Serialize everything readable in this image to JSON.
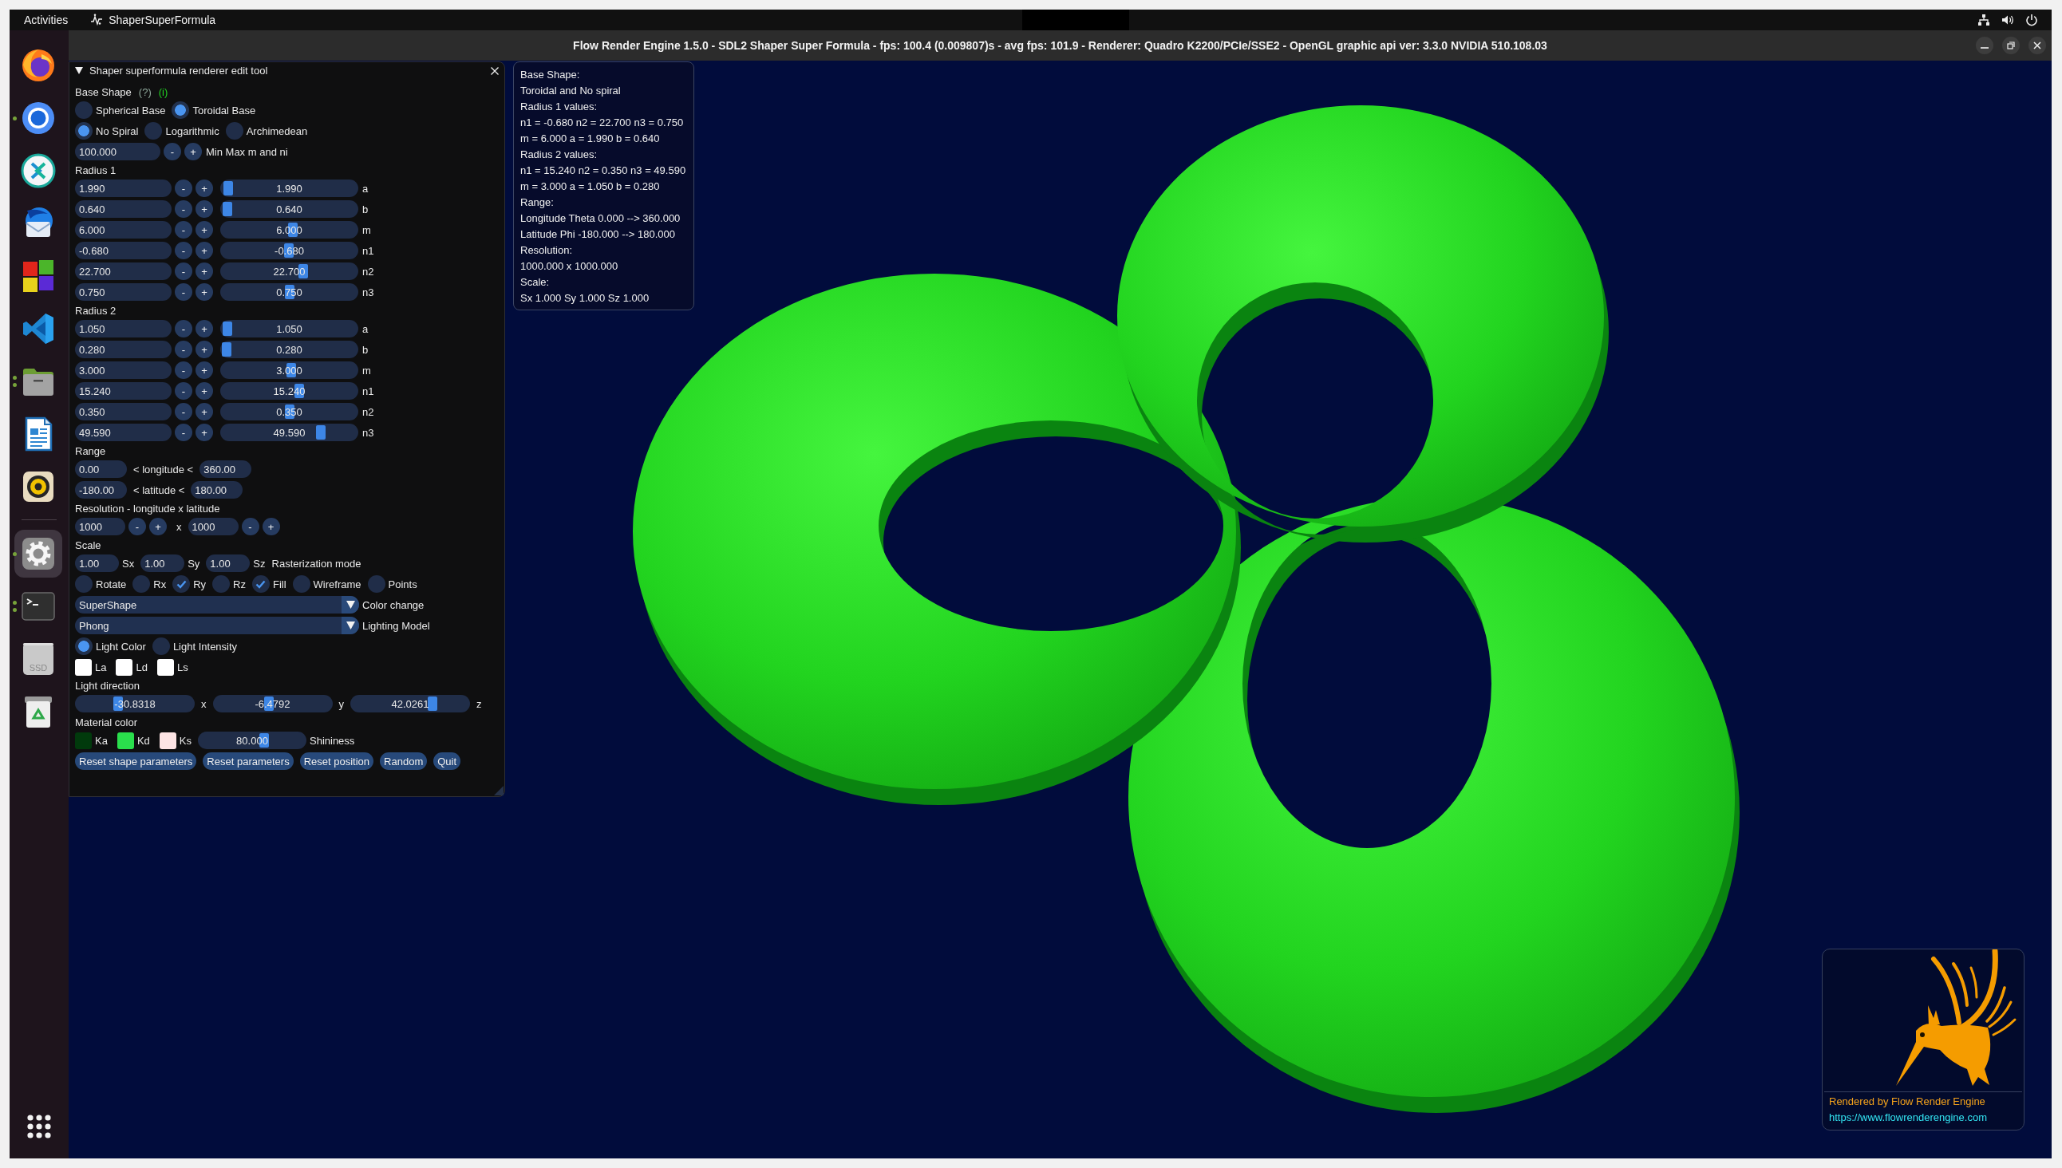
{
  "top_bar": {
    "activities": "Activities",
    "app_menu": "ShaperSuperFormula"
  },
  "dock": {
    "pinned": [
      {
        "kind": "fox",
        "running": false,
        "extra_window": false,
        "selected": false
      },
      {
        "kind": "ring",
        "running": true,
        "extra_window": false,
        "selected": false
      },
      {
        "kind": "arrows",
        "running": false,
        "extra_window": false,
        "selected": false
      },
      {
        "kind": "mail",
        "running": false,
        "extra_window": false,
        "selected": false
      },
      {
        "kind": "tiles",
        "running": false,
        "extra_window": false,
        "selected": false
      },
      {
        "kind": "code",
        "running": false,
        "extra_window": false,
        "selected": false
      },
      {
        "kind": "folder",
        "running": true,
        "extra_window": true,
        "selected": false
      },
      {
        "kind": "document",
        "running": false,
        "extra_window": false,
        "selected": false
      },
      {
        "kind": "speaker",
        "running": false,
        "extra_window": false,
        "selected": false
      }
    ],
    "running": [
      {
        "kind": "gear",
        "running": true,
        "extra_window": false,
        "selected": true
      },
      {
        "kind": "terminal",
        "running": true,
        "extra_window": true,
        "selected": false
      },
      {
        "kind": "disk",
        "label": "SSD",
        "running": false,
        "extra_window": false,
        "selected": false
      },
      {
        "kind": "trash",
        "running": false,
        "extra_window": false,
        "selected": false
      }
    ]
  },
  "window": {
    "title": "Flow Render Engine 1.5.0 - SDL2 Shaper Super Formula - fps: 100.4 (0.009807)s - avg fps: 101.9 - Renderer: Quadro K2200/PCIe/SSE2 - OpenGL graphic api ver: 3.3.0 NVIDIA 510.108.03"
  },
  "edit_panel": {
    "title": "Shaper superformula renderer edit tool",
    "expanded": true,
    "base_shape": {
      "label": "Base Shape",
      "help": "(?)",
      "info": "(i)"
    },
    "base_options": [
      {
        "label": "Spherical Base",
        "selected": false
      },
      {
        "label": "Toroidal Base",
        "selected": true
      }
    ],
    "spiral_options": [
      {
        "label": "No Spiral",
        "selected": true
      },
      {
        "label": "Logarithmic",
        "selected": false
      },
      {
        "label": "Archimedean",
        "selected": false
      }
    ],
    "min_max": {
      "value": "100.000",
      "minus": "-",
      "plus": "+",
      "label": "Min Max m and ni"
    },
    "radius_groups": [
      {
        "label": "Radius 1",
        "params": [
          {
            "value": "1.990",
            "minus": "-",
            "plus": "+",
            "slider_value": "1.990",
            "level": 0.013,
            "name": "a"
          },
          {
            "value": "0.640",
            "minus": "-",
            "plus": "+",
            "slider_value": "0.640",
            "level": 0.004,
            "name": "b"
          },
          {
            "value": "6.000",
            "minus": "-",
            "plus": "+",
            "slider_value": "6.000",
            "level": 0.53,
            "name": "m"
          },
          {
            "value": "-0.680",
            "minus": "-",
            "plus": "+",
            "slider_value": "-0.680",
            "level": 0.494,
            "name": "n1"
          },
          {
            "value": "22.700",
            "minus": "-",
            "plus": "+",
            "slider_value": "22.700",
            "level": 0.614,
            "name": "n2"
          },
          {
            "value": "0.750",
            "minus": "-",
            "plus": "+",
            "slider_value": "0.750",
            "level": 0.504,
            "name": "n3"
          }
        ]
      },
      {
        "label": "Radius 2",
        "params": [
          {
            "value": "1.050",
            "minus": "-",
            "plus": "+",
            "slider_value": "1.050",
            "level": 0.007,
            "name": "a"
          },
          {
            "value": "0.280",
            "minus": "-",
            "plus": "+",
            "slider_value": "0.280",
            "level": 0.002,
            "name": "b"
          },
          {
            "value": "3.000",
            "minus": "-",
            "plus": "+",
            "slider_value": "3.000",
            "level": 0.517,
            "name": "m"
          },
          {
            "value": "15.240",
            "minus": "-",
            "plus": "+",
            "slider_value": "15.240",
            "level": 0.579,
            "name": "n1"
          },
          {
            "value": "0.350",
            "minus": "-",
            "plus": "+",
            "slider_value": "0.350",
            "level": 0.504,
            "name": "n2"
          },
          {
            "value": "49.590",
            "minus": "-",
            "plus": "+",
            "slider_value": "49.590",
            "level": 0.751,
            "name": "n3"
          }
        ]
      }
    ],
    "range": {
      "label": "Range",
      "rows": [
        {
          "min": "0.00",
          "relation": "< longitude <",
          "max": "360.00"
        },
        {
          "min": "-180.00",
          "relation": "< latitude <",
          "max": "180.00"
        }
      ]
    },
    "resolution": {
      "label": "Resolution - longitude x latitude",
      "fields": [
        {
          "value": "1000",
          "minus": "-",
          "plus": "+"
        },
        {
          "value": "1000",
          "minus": "-",
          "plus": "+"
        }
      ],
      "separator": "x"
    },
    "scale": {
      "label": "Scale",
      "fields": [
        {
          "value": "1.00",
          "axis": "Sx"
        },
        {
          "value": "1.00",
          "axis": "Sy"
        },
        {
          "value": "1.00",
          "axis": "Sz"
        }
      ],
      "mode_label": "Rasterization mode"
    },
    "toggles": [
      {
        "label": "Rotate",
        "checked": false
      },
      {
        "label": "Rx",
        "checked": false
      },
      {
        "label": "Ry",
        "checked": true
      },
      {
        "label": "Rz",
        "checked": false
      },
      {
        "label": "Fill",
        "checked": true
      },
      {
        "label": "Wireframe",
        "checked": false
      },
      {
        "label": "Points",
        "checked": false
      }
    ],
    "combos": [
      {
        "value": "SuperShape",
        "label": "Color change"
      },
      {
        "value": "Phong",
        "label": "Lighting Model"
      }
    ],
    "light_modes": [
      {
        "label": "Light Color",
        "selected": true
      },
      {
        "label": "Light Intensity",
        "selected": false
      }
    ],
    "light_colors": [
      {
        "label": "La",
        "color": "#ffffff"
      },
      {
        "label": "Ld",
        "color": "#ffffff"
      },
      {
        "label": "Ls",
        "color": "#ffffff"
      }
    ],
    "light_direction": {
      "label": "Light direction",
      "sliders": [
        {
          "value": "-30.8318",
          "level": 0.342,
          "axis": "x"
        },
        {
          "value": "-6.4792",
          "level": 0.465,
          "axis": "y"
        },
        {
          "value": "42.0261",
          "level": 0.71,
          "axis": "z"
        }
      ]
    },
    "material": {
      "label": "Material color",
      "colors": [
        {
          "label": "Ka",
          "color": "#013a0c"
        },
        {
          "label": "Kd",
          "color": "#2ade4c"
        },
        {
          "label": "Ks",
          "color": "#fde4e4"
        }
      ],
      "shininess": {
        "value": "80.000",
        "level": 0.627,
        "label": "Shininess"
      }
    },
    "buttons": [
      "Reset shape parameters",
      "Reset parameters",
      "Reset position",
      "Random",
      "Quit"
    ]
  },
  "info_box": {
    "lines": [
      "Base Shape:",
      "Toroidal and No spiral",
      "Radius 1 values:",
      "n1 = -0.680 n2 = 22.700 n3 = 0.750",
      "m = 6.000 a = 1.990 b = 0.640",
      "Radius 2 values:",
      "n1 = 15.240 n2 = 0.350 n3 = 49.590",
      "m = 3.000 a = 1.050 b = 0.280",
      "Range:",
      "Longitude Theta 0.000 --> 360.000",
      "Latitude Phi -180.000 --> 180.000",
      "Resolution:",
      "1000.000 x 1000.000",
      "Scale:",
      "Sx 1.000 Sy 1.000 Sz 1.000"
    ]
  },
  "logo": {
    "caption": "Rendered by Flow Render Engine",
    "url": "https://www.flowrenderengine.com"
  }
}
